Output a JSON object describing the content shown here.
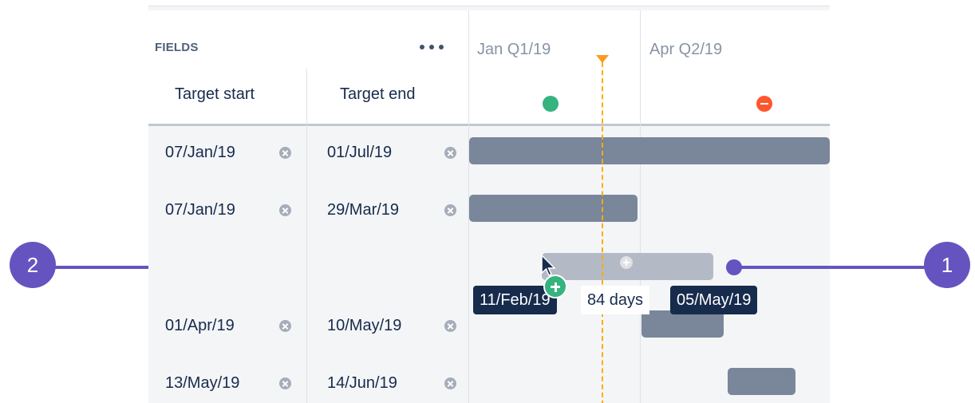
{
  "fields_panel": {
    "label": "FIELDS",
    "more_icon": "more-horizontal-icon",
    "columns": [
      "Target start",
      "Target end"
    ]
  },
  "timeline": {
    "quarters": [
      "Jan Q1/19",
      "Apr Q2/19"
    ],
    "status_icons": [
      "status-dot-green-icon",
      "status-minus-red-icon"
    ],
    "today_marker_color": "#ff991f"
  },
  "rows": [
    {
      "start": "07/Jan/19",
      "end": "01/Jul/19"
    },
    {
      "start": "07/Jan/19",
      "end": "29/Mar/19"
    },
    {
      "start": "",
      "end": ""
    },
    {
      "start": "01/Apr/19",
      "end": "10/May/19"
    },
    {
      "start": "13/May/19",
      "end": "14/Jun/19"
    }
  ],
  "drag_preview": {
    "start_label": "11/Feb/19",
    "duration_label": "84 days",
    "end_label": "05/May/19"
  },
  "callouts": [
    {
      "number": "1"
    },
    {
      "number": "2"
    }
  ],
  "colors": {
    "bar": "#7a869a",
    "bar_preview": "#b3bac5",
    "label_dark": "#172b4d",
    "callout": "#6554c0",
    "success": "#36b37e",
    "danger": "#ff5630"
  }
}
